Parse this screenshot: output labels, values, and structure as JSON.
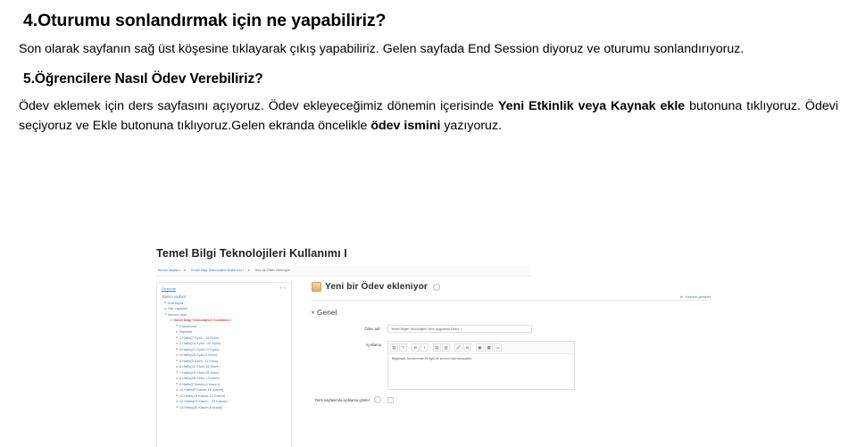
{
  "document": {
    "heading_1": "4.Oturumu sonlandırmak için ne yapabiliriz?",
    "paragraph_1": "Son olarak sayfanın sağ üst köşesine tıklayarak çıkış yapabiliriz. Gelen sayfada End Session diyoruz ve oturumu sonlandırıyoruz.",
    "heading_2": "5.Öğrencilere Nasıl Ödev Verebiliriz?",
    "paragraph_2": {
      "part_1": "Ödev eklemek için ders sayfasını açıyoruz. Ödev ekleyeceğimiz dönemin içerisinde ",
      "bold_1": "Yeni Etkinlik veya Kaynak ekle",
      "part_2": " butonuna tıklıyoruz. Ödevi seçiyoruz ve Ekle butonuna tıklıyoruz.Gelen ekranda öncelikle ",
      "bold_2": "ödev ismini",
      "part_3": " yazıyoruz."
    }
  },
  "screenshot": {
    "course_title": "Temel Bilgi Teknolojileri Kullanımı I",
    "breadcrumb": {
      "item_1": "Benim sayfam",
      "sep": "►",
      "item_2": "Temel Bilgi Teknolojileri Kullanımı I",
      "item_3": "Yeni bir Ödev ekleniyor"
    },
    "nav": {
      "panel_title": "Gezinme",
      "panel_controls": "▾ ▾",
      "section_label": "Benim sayfam",
      "items": [
        {
          "label": "Ana sayfa",
          "twisty": "►",
          "level": 1,
          "current": false
        },
        {
          "label": "Site sayfaları",
          "twisty": "►",
          "level": 1,
          "current": false
        },
        {
          "label": "Mevcut ders",
          "twisty": "▾",
          "level": 1,
          "current": false
        },
        {
          "label": "Temel Bilgi Teknolojileri Kullanımı I",
          "twisty": "▾",
          "level": 2,
          "current": true
        },
        {
          "label": "Katılımcılar",
          "twisty": "►",
          "level": 3,
          "current": false
        },
        {
          "label": "Nişanlar",
          "twisty": "►",
          "level": 3,
          "current": false
        },
        {
          "label": "1.Hafta(7 Eylül - 13 Eylül)",
          "twisty": "►",
          "level": 3,
          "current": false
        },
        {
          "label": "2.Hafta(14 Eylül - 20 Eylül)",
          "twisty": "►",
          "level": 3,
          "current": false
        },
        {
          "label": "3.Hafta(21 Eylül-27 Eylül)",
          "twisty": "►",
          "level": 3,
          "current": false
        },
        {
          "label": "4.Hafta(28 Eylül-4 Ekim)",
          "twisty": "►",
          "level": 3,
          "current": false
        },
        {
          "label": "5.Hafta(5 Ekim- 11 Ekim)",
          "twisty": "►",
          "level": 3,
          "current": false
        },
        {
          "label": "6.Hafta(12 Ekim-18 Ekim)",
          "twisty": "►",
          "level": 3,
          "current": false
        },
        {
          "label": "7.Hafta(19 Ekim-25 Ekim)",
          "twisty": "►",
          "level": 3,
          "current": false
        },
        {
          "label": "8.Hafta(26 Ekim-1 Kasım)",
          "twisty": "►",
          "level": 3,
          "current": false
        },
        {
          "label": "9.Hafta(2 Kasım-8 Kasım)",
          "twisty": "►",
          "level": 3,
          "current": false
        },
        {
          "label": "10.Hafta(9 Kasım-15 Kasım)",
          "twisty": "►",
          "level": 3,
          "current": false
        },
        {
          "label": "11.Hafta(16 Kasım-22 Kasım)",
          "twisty": "►",
          "level": 3,
          "current": false
        },
        {
          "label": "12.Hafta(23 Kasım - 29 Kasım)",
          "twisty": "►",
          "level": 3,
          "current": false
        },
        {
          "label": "13.Hafta(30 Kasım-6 Aralık)",
          "twisty": "►",
          "level": 3,
          "current": false
        }
      ]
    },
    "form": {
      "title": "Yeni bir Ödev ekleniyor",
      "expand_all": "Hepsini genişlet",
      "expand_all_twisty": "►",
      "section_title": "Genel",
      "section_twisty": "▾",
      "odev_adi_label": "Ödev adı",
      "odev_adi_required": "*",
      "odev_adi_value": "Temel Bilgim Teknolojileri Ders Uygulama Ödevi 1",
      "aciklama_label": "Açıklama",
      "aciklama_value": "Bilgisayar Donanımları ile ilgili bir sunum hazırlanacaktır.",
      "toolbar_buttons": [
        {
          "name": "paragraph-style-icon",
          "glyph": "▤"
        },
        {
          "name": "undo-icon",
          "glyph": "↰"
        },
        {
          "name": "bold-icon",
          "glyph": "B"
        },
        {
          "name": "italic-icon",
          "glyph": "I"
        },
        {
          "name": "bullet-list-icon",
          "glyph": "▤"
        },
        {
          "name": "numbered-list-icon",
          "glyph": "▥"
        },
        {
          "name": "link-icon",
          "glyph": "🖉"
        },
        {
          "name": "unlink-icon",
          "glyph": "⊘"
        },
        {
          "name": "image-icon",
          "glyph": "▣"
        },
        {
          "name": "media-icon",
          "glyph": "▦"
        },
        {
          "name": "file-icon",
          "glyph": "▭"
        }
      ],
      "show_description_label": "Ders sayfasında açıklama göster",
      "show_description_checked": false
    }
  },
  "colors": {
    "link": "#4a7fae",
    "current_item": "#d24a43",
    "border": "#e4e7ea",
    "text": "#3b4045"
  }
}
